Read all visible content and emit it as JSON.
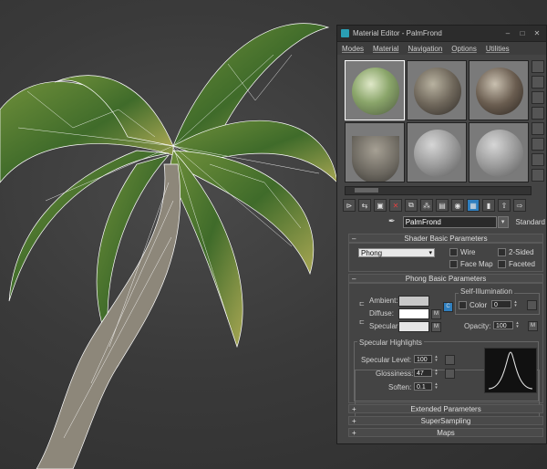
{
  "window": {
    "title": "Material Editor - PalmFrond",
    "min": "–",
    "max": "□",
    "close": "✕"
  },
  "menu": [
    "Modes",
    "Material",
    "Navigation",
    "Options",
    "Utilities"
  ],
  "material": {
    "name": "PalmFrond",
    "type": "Standard"
  },
  "rollouts": {
    "shader_basic": "Shader Basic Parameters",
    "phong_basic": "Phong Basic Parameters",
    "extended": "Extended Parameters",
    "supersampling": "SuperSampling",
    "maps": "Maps"
  },
  "shader": {
    "selected": "Phong",
    "wire": "Wire",
    "two_sided": "2-Sided",
    "face_map": "Face Map",
    "faceted": "Faceted"
  },
  "phong": {
    "ambient": "Ambient:",
    "diffuse": "Diffuse:",
    "specular": "Specular:",
    "m": "M",
    "lock_c": "C",
    "self_illum_title": "Self-Illumination",
    "color_label": "Color",
    "color_value": "0",
    "opacity_label": "Opacity:",
    "opacity_value": "100"
  },
  "highlights": {
    "title": "Specular Highlights",
    "spec_level_label": "Specular Level:",
    "spec_level": "100",
    "glossiness_label": "Glossiness:",
    "glossiness": "47",
    "soften_label": "Soften:",
    "soften": "0.1"
  },
  "colors": {
    "ambient": "#c8c8c8",
    "diffuse": "#ffffff",
    "specular": "#e6e6e6",
    "accent": "#2f7fbf"
  }
}
